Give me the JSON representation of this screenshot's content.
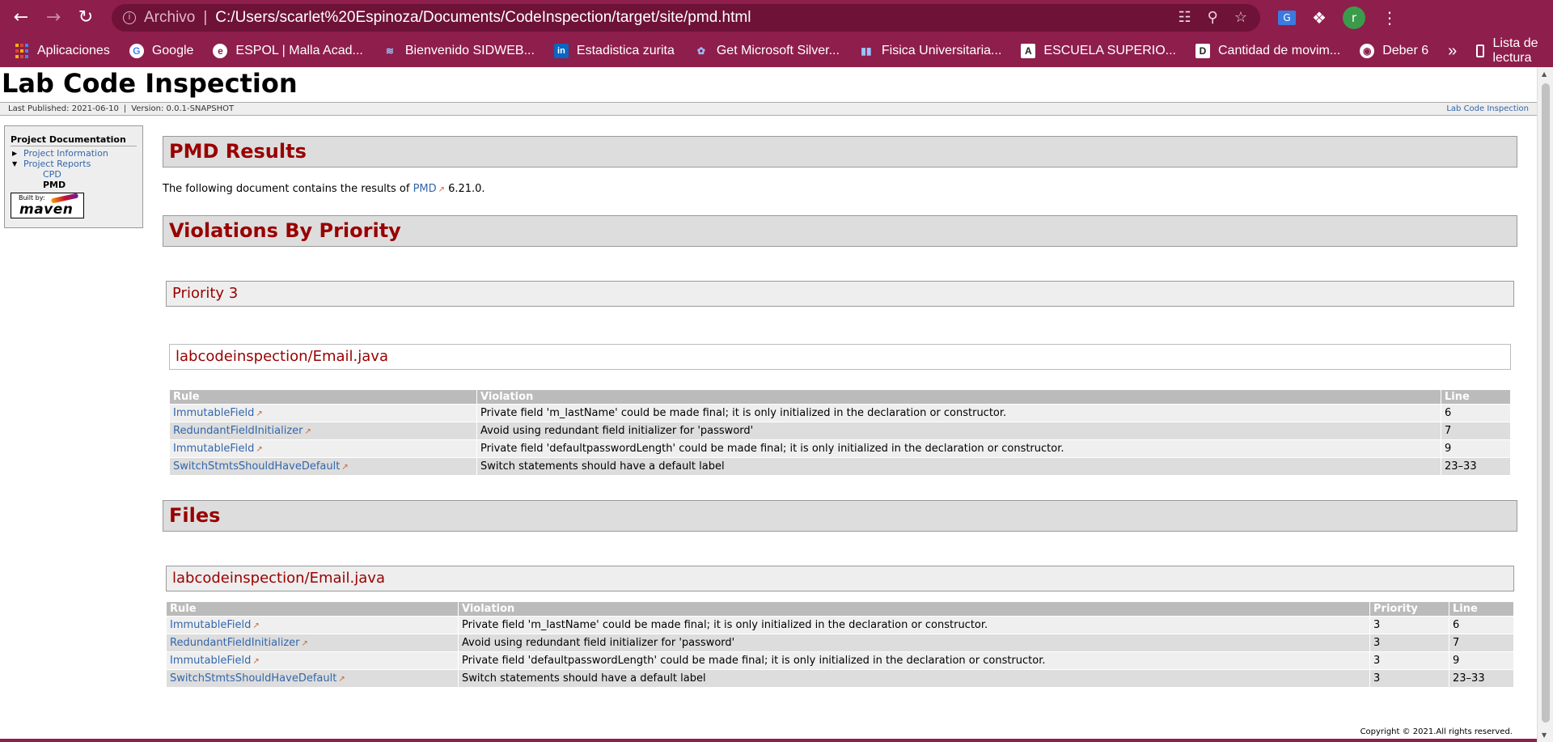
{
  "browser": {
    "address": {
      "scheme_label": "Archivo",
      "url": "C:/Users/scarlet%20Espinoza/Documents/CodeInspection/target/site/pmd.html"
    },
    "avatar_letter": "r",
    "bookmarks": [
      {
        "label": "Aplicaciones",
        "icon": "apps-grid-icon"
      },
      {
        "label": "Google",
        "icon": "google-icon"
      },
      {
        "label": "ESPOL | Malla Acad...",
        "icon": "espol-icon"
      },
      {
        "label": "Bienvenido SIDWEB...",
        "icon": "sidweb-icon"
      },
      {
        "label": "Estadistica zurita",
        "icon": "linkedin-icon"
      },
      {
        "label": "Get Microsoft Silver...",
        "icon": "silverlight-icon"
      },
      {
        "label": "Fisica Universitaria...",
        "icon": "chart-icon"
      },
      {
        "label": "ESCUELA SUPERIO...",
        "icon": "a-letter-icon"
      },
      {
        "label": "Cantidad de movim...",
        "icon": "d-letter-icon"
      },
      {
        "label": "Deber 6",
        "icon": "globe-icon"
      }
    ],
    "more_label": "»",
    "reading_list_label": "Lista de lectura"
  },
  "site": {
    "title": "Lab Code Inspection",
    "published": "Last Published: 2021-06-10",
    "version": "Version: 0.0.1-SNAPSHOT",
    "bc_right": "Lab Code Inspection",
    "copyright": "Copyright © 2021.All rights reserved."
  },
  "nav": {
    "heading": "Project Documentation",
    "items": [
      {
        "label": "Project Information"
      },
      {
        "label": "Project Reports"
      }
    ],
    "sub_items": [
      {
        "label": "CPD"
      },
      {
        "label": "PMD"
      }
    ],
    "built_by": "Built by:",
    "maven": "maven"
  },
  "content": {
    "pmd_heading": "PMD Results",
    "intro_before": "The following document contains the results of",
    "intro_link": "PMD",
    "intro_after": "6.21.0.",
    "violations_heading": "Violations By Priority",
    "priority_heading": "Priority 3",
    "file_heading": "labcodeinspection/Email.java",
    "table1": {
      "headers": [
        "Rule",
        "Violation",
        "Line"
      ],
      "rows": [
        {
          "rule": "ImmutableField",
          "violation": "Private field 'm_lastName' could be made final; it is only initialized in the declaration or constructor.",
          "line": "6"
        },
        {
          "rule": "RedundantFieldInitializer",
          "violation": "Avoid using redundant field initializer for 'password'",
          "line": "7"
        },
        {
          "rule": "ImmutableField",
          "violation": "Private field 'defaultpasswordLength' could be made final; it is only initialized in the declaration or constructor.",
          "line": "9"
        },
        {
          "rule": "SwitchStmtsShouldHaveDefault",
          "violation": "Switch statements should have a default label",
          "line": "23–33"
        }
      ]
    },
    "files_heading": "Files",
    "files_file_heading": "labcodeinspection/Email.java",
    "table2": {
      "headers": [
        "Rule",
        "Violation",
        "Priority",
        "Line"
      ],
      "rows": [
        {
          "rule": "ImmutableField",
          "violation": "Private field 'm_lastName' could be made final; it is only initialized in the declaration or constructor.",
          "priority": "3",
          "line": "6"
        },
        {
          "rule": "RedundantFieldInitializer",
          "violation": "Avoid using redundant field initializer for 'password'",
          "priority": "3",
          "line": "7"
        },
        {
          "rule": "ImmutableField",
          "violation": "Private field 'defaultpasswordLength' could be made final; it is only initialized in the declaration or constructor.",
          "priority": "3",
          "line": "9"
        },
        {
          "rule": "SwitchStmtsShouldHaveDefault",
          "violation": "Switch statements should have a default label",
          "priority": "3",
          "line": "23–33"
        }
      ]
    }
  },
  "colors": {
    "chrome": "#8e1e4c",
    "heading": "#990000",
    "link": "#3366aa"
  }
}
